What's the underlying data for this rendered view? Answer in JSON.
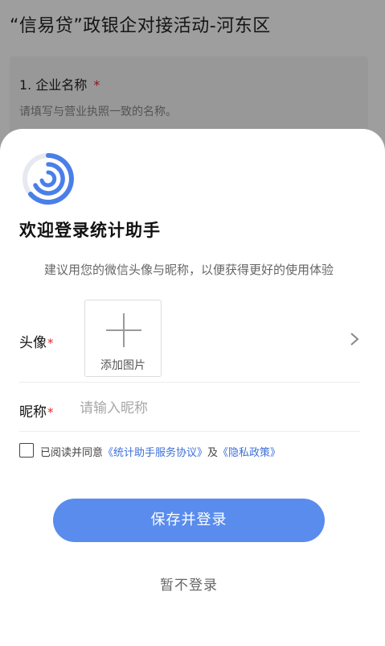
{
  "background": {
    "title": "“信易贷”政银企对接活动-河东区",
    "question": {
      "label": "1. 企业名称",
      "required_mark": "*",
      "hint": "请填写与营业执照一致的名称。"
    }
  },
  "sheet": {
    "logo_icon": "app-logo-icon",
    "title": "欢迎登录统计助手",
    "subtitle": "建议用您的微信头像与昵称，以便获得更好的使用体验",
    "avatar": {
      "label": "头像",
      "required_mark": "*",
      "upload_text": "添加图片"
    },
    "nickname": {
      "label": "昵称",
      "required_mark": "*",
      "placeholder": "请输入昵称",
      "value": ""
    },
    "agreement": {
      "prefix": "已阅读并同意",
      "service_link": "《统计助手服务协议》",
      "joiner": "及",
      "privacy_link": "《隐私政策》",
      "checked": false
    },
    "save_button": "保存并登录",
    "skip_button": "暂不登录"
  },
  "colors": {
    "accent": "#5a8cee",
    "link": "#3c6fd8",
    "required": "#e0282e",
    "logo": "#4a7fe8"
  }
}
